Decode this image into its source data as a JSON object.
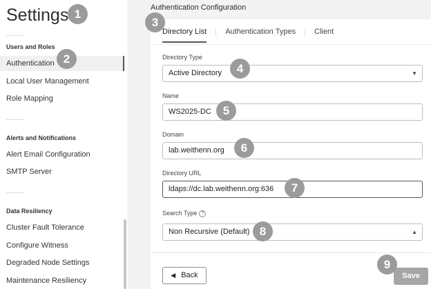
{
  "sidebar": {
    "title": "Settings",
    "sections": [
      {
        "heading": "Users and Roles",
        "items": [
          "Authentication",
          "Local User Management",
          "Role Mapping"
        ]
      },
      {
        "heading": "Alerts and Notifications",
        "items": [
          "Alert Email Configuration",
          "SMTP Server"
        ]
      },
      {
        "heading": "Data Resiliency",
        "items": [
          "Cluster Fault Tolerance",
          "Configure Witness",
          "Degraded Node Settings",
          "Maintenance Resiliency"
        ]
      }
    ],
    "active_item": "Authentication"
  },
  "main": {
    "title": "Authentication Configuration",
    "tabs": [
      {
        "label": "Directory List",
        "active": true
      },
      {
        "label": "Authentication Types",
        "active": false
      },
      {
        "label": "Client",
        "active": false
      }
    ]
  },
  "form": {
    "directory_type": {
      "label": "Directory Type",
      "value": "Active Directory"
    },
    "name": {
      "label": "Name",
      "value": "WS2025-DC"
    },
    "domain": {
      "label": "Domain",
      "value": "lab.weithenn.org"
    },
    "directory_url": {
      "label": "Directory URL",
      "value": "ldaps://dc.lab.weithenn.org:636"
    },
    "search_type": {
      "label": "Search Type",
      "value": "Non Recursive (Default)"
    }
  },
  "actions": {
    "back_label": "Back",
    "save_label": "Save"
  },
  "badges": [
    "1",
    "2",
    "3",
    "4",
    "5",
    "6",
    "7",
    "8",
    "9"
  ],
  "colors": {
    "badge": "#9b9b9b",
    "save_disabled": "#a6a6a6",
    "main_bg": "#f3f3f3"
  }
}
